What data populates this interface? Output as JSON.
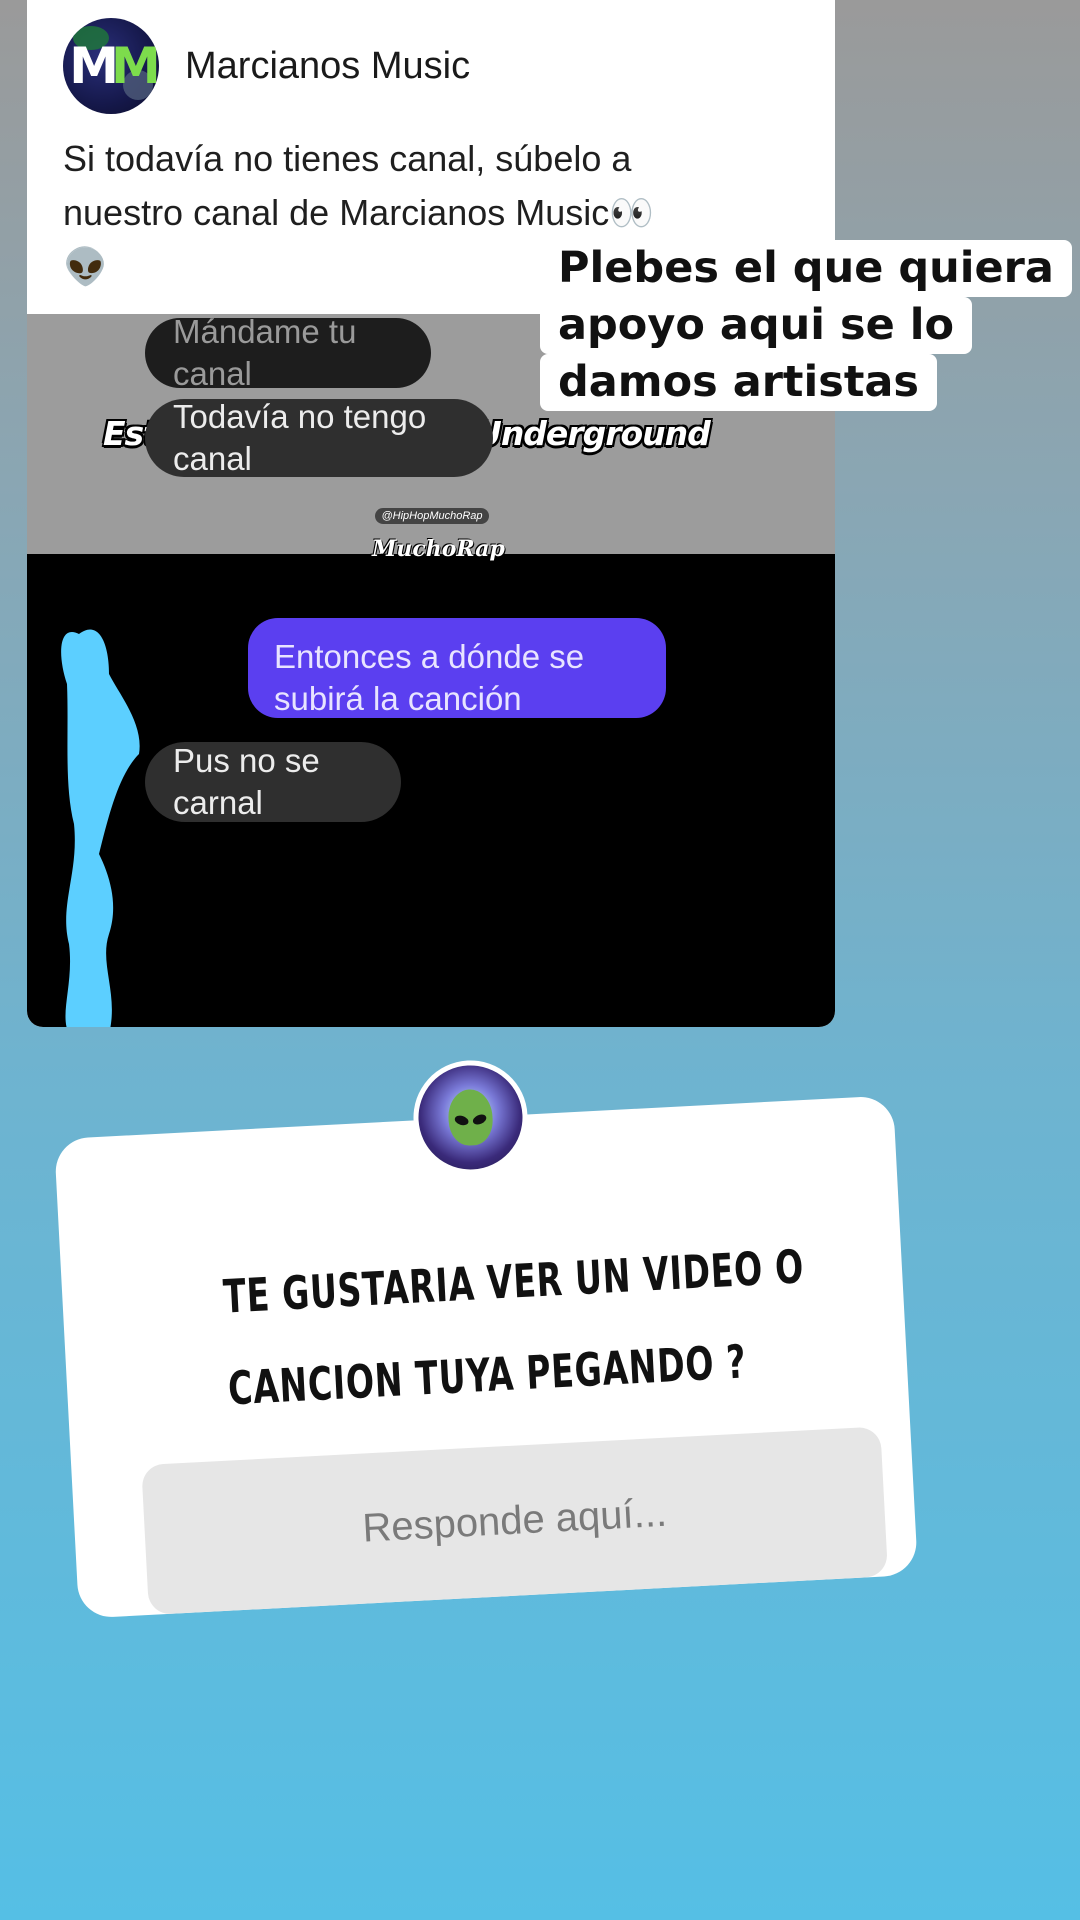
{
  "post": {
    "channel_name": "Marcianos Music",
    "avatar_logo": "MM",
    "text_line1": "Si todavía no tienes canal, súbelo a",
    "text_line2": "nuestro canal de Marcianos Music👀",
    "text_line3": "👽"
  },
  "embed": {
    "headline": "Este es el verdadero Underground",
    "watermark_handle": "@HipHopMuchoRap",
    "watermark_mark": "MuchoRap",
    "messages": [
      {
        "text": "Mándame tu canal",
        "side": "left"
      },
      {
        "text": "Todavía no tengo canal",
        "side": "left"
      },
      {
        "text": "Entonces a dónde se subirá la canción",
        "side": "right"
      },
      {
        "text": "Pus no se carnal",
        "side": "left"
      }
    ]
  },
  "overlay_caption": {
    "line1": "Plebes el que quiera",
    "line2": "apoyo aqui se lo",
    "line3": "damos artistas"
  },
  "question_sticker": {
    "question_line1": "TE GUSTARIA VER UN VIDEO O",
    "question_line2": "CANCION TUYA PEGANDO ?",
    "answer_placeholder": "Responde aquí..."
  },
  "colors": {
    "background_top": "#9a9a9a",
    "background_bottom": "#55bfe5",
    "sent_bubble": "#5b3ff0",
    "received_bubble": "#2f2f2f",
    "scribble": "#5ccfff"
  },
  "icons": {
    "channel_avatar": "marcianos-music-logo",
    "sticker_avatar": "alien-avatar"
  }
}
